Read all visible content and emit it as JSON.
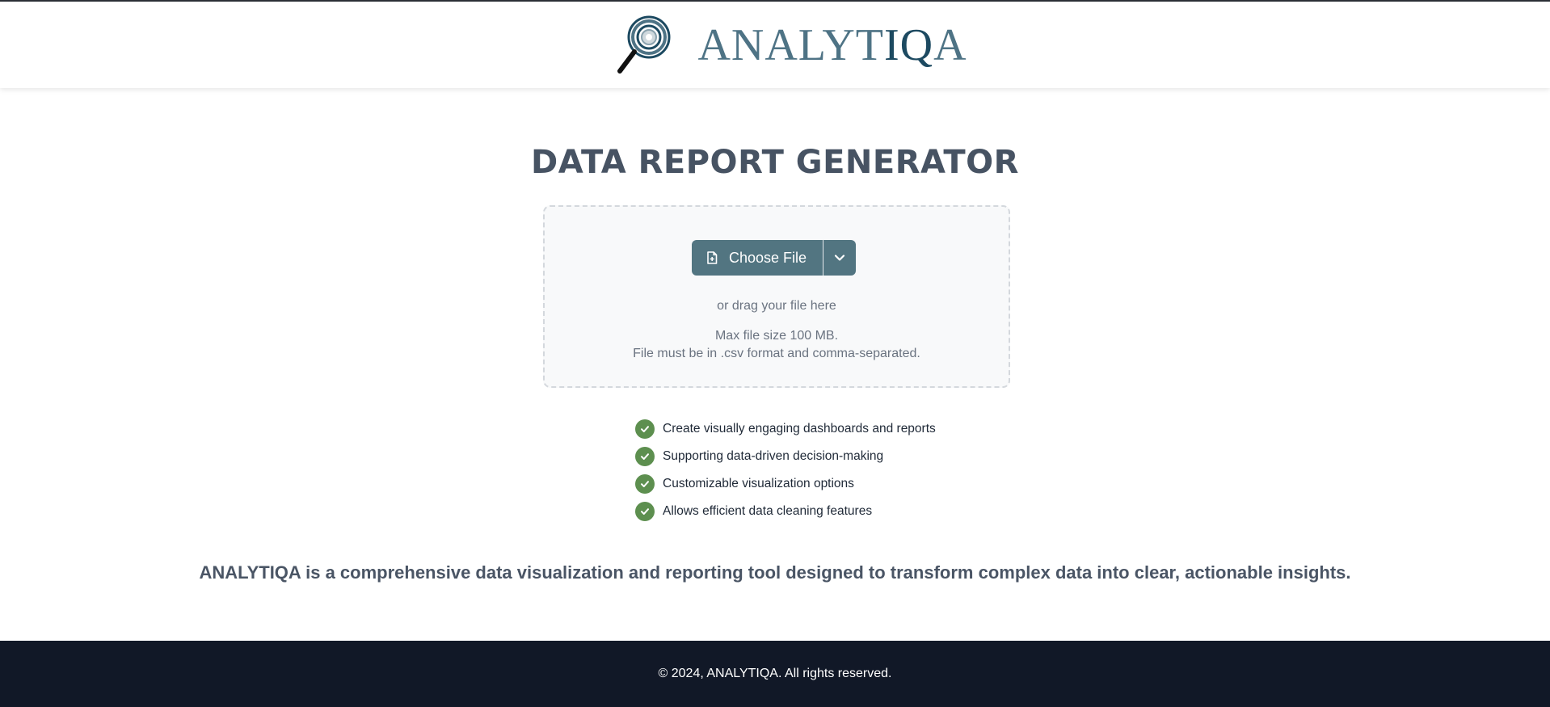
{
  "header": {
    "logo_icon": "magnifying-glass-target-icon",
    "brand_part1": "ANALYT",
    "brand_part2": "IQ",
    "brand_part3": "A",
    "brand_color": "#4e7385",
    "brand_dark_color": "#1d4a61"
  },
  "main": {
    "title": "DATA REPORT GENERATOR",
    "upload": {
      "button_label": "Choose File",
      "button_icon": "file-plus-icon",
      "dropdown_icon": "chevron-down-icon",
      "drag_text": "or drag your file here",
      "max_size_text": "Max file size 100 MB.",
      "format_text": "File must be in .csv format and comma-separated.",
      "button_color": "#527581"
    },
    "features": [
      "Create visually engaging dashboards and reports",
      "Supporting data-driven decision-making",
      "Customizable visualization options",
      "Allows efficient data cleaning features"
    ],
    "feature_icon": "check-circle-icon",
    "check_color": "#5d8f4f",
    "tagline": "ANALYTIQA is a comprehensive data visualization and reporting tool designed to transform complex data into clear, actionable insights."
  },
  "footer": {
    "copyright": "© 2024, ANALYTIQA. All rights reserved.",
    "background": "#111827"
  }
}
